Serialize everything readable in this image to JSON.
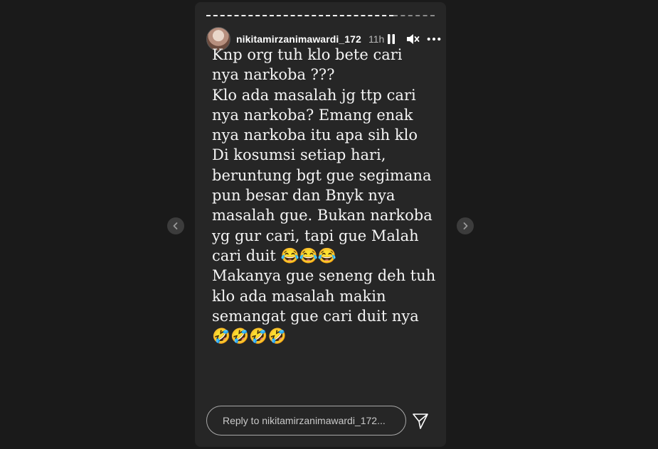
{
  "story": {
    "user": {
      "username": "nikitamirzanimawardi_172",
      "time_ago": "11h",
      "avatar_icon": "profile-avatar"
    },
    "progress": {
      "fraction_played": 0.82
    },
    "controls": {
      "pause_icon": "pause-icon",
      "mute_icon": "mute-icon",
      "more_icon": "more-options-icon"
    },
    "text_lines": [
      "Knp org tuh klo bete cari",
      "nya narkoba ???",
      "Klo ada masalah jg ttp cari",
      "nya narkoba? Emang enak",
      "nya narkoba itu apa sih klo",
      "Di kosumsi setiap hari,",
      "beruntung bgt gue segimana",
      "pun besar dan Bnyk nya",
      "masalah gue. Bukan narkoba",
      "yg gur cari, tapi gue Malah",
      "cari duit 😂😂😂",
      "Makanya gue seneng deh tuh",
      "klo ada masalah makin",
      "semangat gue cari duit nya",
      "🤣🤣🤣🤣"
    ],
    "reply": {
      "placeholder": "Reply to nikitamirzanimawardi_172...",
      "send_icon": "send-icon"
    }
  },
  "navigation": {
    "prev_icon": "chevron-left-icon",
    "next_icon": "chevron-right-icon"
  },
  "colors": {
    "page_background": "#1a1a1a",
    "story_background": "#262626",
    "text": "#f5f5f5"
  }
}
